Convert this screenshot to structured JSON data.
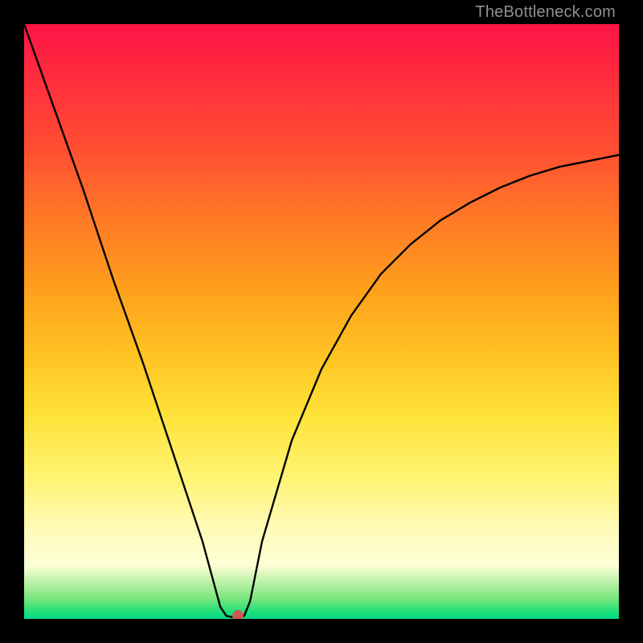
{
  "watermark": "TheBottleneck.com",
  "colors": {
    "background": "#000000",
    "curve": "#000000",
    "dot": "#cc5c51"
  },
  "chart_data": {
    "type": "line",
    "title": "",
    "xlabel": "",
    "ylabel": "",
    "xlim": [
      0,
      100
    ],
    "ylim": [
      0,
      100
    ],
    "grid": false,
    "legend": false,
    "series": [
      {
        "name": "curve",
        "x": [
          0,
          5,
          10,
          15,
          20,
          25,
          30,
          33,
          34,
          35,
          36,
          37,
          38,
          40,
          45,
          50,
          55,
          60,
          65,
          70,
          75,
          80,
          85,
          90,
          95,
          100
        ],
        "values": [
          100,
          86,
          72,
          57,
          43,
          28,
          13,
          2,
          0.5,
          0.3,
          0.4,
          0.5,
          3,
          13,
          30,
          42,
          51,
          58,
          63,
          67,
          70,
          72.5,
          74.5,
          76,
          77,
          78
        ]
      }
    ],
    "annotations": [
      {
        "type": "marker",
        "x": 36,
        "y": 0.6,
        "shape": "circle",
        "color": "#cc5c51"
      }
    ],
    "background_gradient": {
      "direction": "vertical",
      "stops": [
        {
          "pos": 0.0,
          "color": "#ff1347"
        },
        {
          "pos": 0.2,
          "color": "#ff4b33"
        },
        {
          "pos": 0.45,
          "color": "#ffa11c"
        },
        {
          "pos": 0.66,
          "color": "#ffe33a"
        },
        {
          "pos": 0.84,
          "color": "#fffab3"
        },
        {
          "pos": 0.97,
          "color": "#7de57c"
        },
        {
          "pos": 1.0,
          "color": "#06d88c"
        }
      ]
    }
  }
}
